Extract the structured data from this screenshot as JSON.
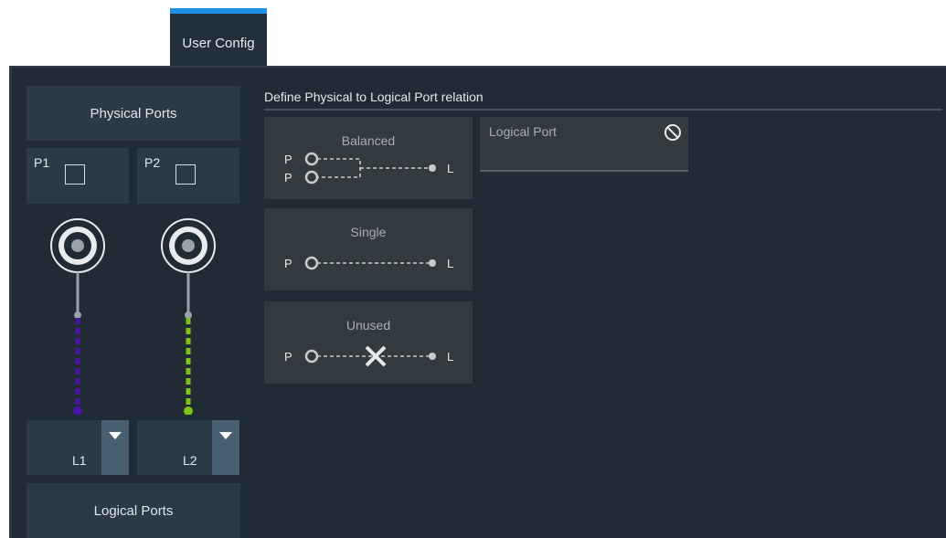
{
  "tab": {
    "label": "User Config",
    "accent": "#1e90e6"
  },
  "left": {
    "physical_ports_label": "Physical Ports",
    "logical_ports_label": "Logical Ports",
    "ports": [
      {
        "label": "P1",
        "checked": false,
        "logical": "L1",
        "line_color": "#4b14a8"
      },
      {
        "label": "P2",
        "checked": false,
        "logical": "L2",
        "line_color": "#7fc21a"
      }
    ]
  },
  "main": {
    "title": "Define Physical to Logical Port relation",
    "options": [
      {
        "title": "Balanced",
        "p1": "P",
        "p2": "P",
        "l": "L"
      },
      {
        "title": "Single",
        "p": "P",
        "l": "L"
      },
      {
        "title": "Unused",
        "p": "P",
        "l": "L"
      }
    ],
    "logical_port_label": "Logical Port",
    "icons": {
      "disabled": "prohibited-icon",
      "dropdown": "triangle-down-icon",
      "connector": "coax-connector-icon",
      "unused": "x-mark-icon"
    }
  }
}
